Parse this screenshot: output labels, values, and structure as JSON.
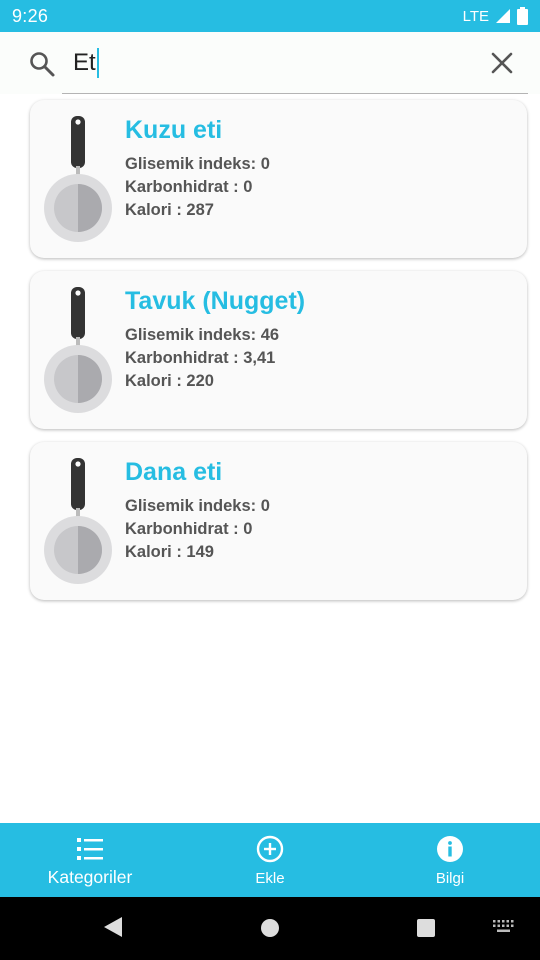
{
  "status_bar": {
    "time": "9:26",
    "network": "LTE"
  },
  "search": {
    "query": "Et"
  },
  "results": [
    {
      "title": "Kuzu eti",
      "gi": "Glisemik indeks: 0",
      "carb": "Karbonhidrat : 0",
      "cal": "Kalori : 287"
    },
    {
      "title": "Tavuk (Nugget)",
      "gi": "Glisemik indeks: 46",
      "carb": "Karbonhidrat : 3,41",
      "cal": "Kalori : 220"
    },
    {
      "title": "Dana eti",
      "gi": "Glisemik indeks: 0",
      "carb": "Karbonhidrat : 0",
      "cal": "Kalori : 149"
    }
  ],
  "bottom_nav": {
    "items": [
      {
        "label": "Kategoriler",
        "icon": "list-icon"
      },
      {
        "label": "Ekle",
        "icon": "add-circle-icon"
      },
      {
        "label": "Bilgi",
        "icon": "info-icon"
      }
    ]
  },
  "colors": {
    "accent": "#26bde2",
    "text": "#555555"
  }
}
